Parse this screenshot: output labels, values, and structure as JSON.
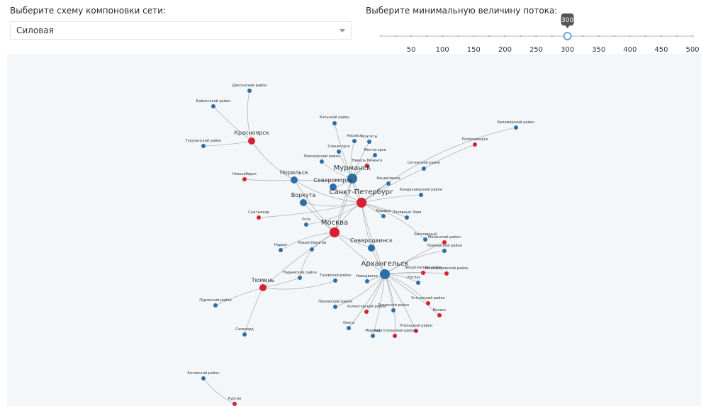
{
  "layout_control": {
    "label": "Выберите схему компоновки сети:",
    "selected": "Силовая"
  },
  "flow_control": {
    "label": "Выберите минимальную величину потока:",
    "value": 300,
    "min": 0,
    "max": 500,
    "step": 25,
    "tick_labels": [
      "50",
      "100",
      "150",
      "200",
      "250",
      "300",
      "350",
      "400",
      "450",
      "500"
    ]
  },
  "colors": {
    "node_blue": "#2e6ea5",
    "node_red": "#d62030",
    "edge": "#999999",
    "slider_track": "#d9dce0",
    "slider_handle": "#6fa4d1",
    "tooltip_bg": "#555555"
  },
  "network": {
    "nodes": [
      {
        "id": "dikson",
        "label": "Диксонский район",
        "type": "blue"
      },
      {
        "id": "baykit",
        "label": "Байкитский район",
        "type": "blue"
      },
      {
        "id": "krasnoyarsk",
        "label": "Красноярск",
        "type": "red",
        "size": "md"
      },
      {
        "id": "turukhansk",
        "label": "Туруханский район",
        "type": "blue"
      },
      {
        "id": "novosibirsk",
        "label": "Новосибирск",
        "type": "red"
      },
      {
        "id": "norilsk",
        "label": "Норильск",
        "type": "blue",
        "size": "md"
      },
      {
        "id": "kola",
        "label": "Кольский район",
        "type": "blue"
      },
      {
        "id": "kirovsk",
        "label": "Кировск",
        "type": "blue"
      },
      {
        "id": "apatity",
        "label": "Апатиты",
        "type": "blue"
      },
      {
        "id": "olenegorsk",
        "label": "Оленегорск",
        "type": "blue"
      },
      {
        "id": "lovozero",
        "label": "Ловозерский район",
        "type": "blue"
      },
      {
        "id": "monchegorsk",
        "label": "Мончегорск",
        "type": "blue"
      },
      {
        "id": "nikel",
        "label": "Никель Печенга",
        "type": "red"
      },
      {
        "id": "murmansk",
        "label": "Мурманск",
        "type": "blue",
        "size": "lg"
      },
      {
        "id": "severomorsk",
        "label": "Североморск",
        "type": "blue",
        "size": "md"
      },
      {
        "id": "segezha",
        "label": "Сегежский район",
        "type": "blue"
      },
      {
        "id": "petrozavodsk",
        "label": "Петрозаводск",
        "type": "red"
      },
      {
        "id": "belomorsk",
        "label": "Беломорский район",
        "type": "blue"
      },
      {
        "id": "kandalaksha",
        "label": "Кандалакша",
        "type": "blue"
      },
      {
        "id": "kandal_r",
        "label": "Кандалакшский район",
        "type": "blue"
      },
      {
        "id": "spb",
        "label": "Санкт-Петербург",
        "type": "red",
        "size": "lg"
      },
      {
        "id": "vorkuta",
        "label": "Воркута",
        "type": "blue",
        "size": "md"
      },
      {
        "id": "syktyvkar",
        "label": "Сыктывкар",
        "type": "red"
      },
      {
        "id": "ukhta",
        "label": "Ухта",
        "type": "blue"
      },
      {
        "id": "kirovsk2",
        "label": "Кировск",
        "type": "blue"
      },
      {
        "id": "polyarnye",
        "label": "Полярные Зори",
        "type": "blue"
      },
      {
        "id": "zapolyarny",
        "label": "Заполярный",
        "type": "blue"
      },
      {
        "id": "moscow",
        "label": "Москва",
        "type": "red",
        "size": "lg"
      },
      {
        "id": "nadym",
        "label": "Надым",
        "type": "blue"
      },
      {
        "id": "urengoy",
        "label": "Новый Уренгой",
        "type": "blue"
      },
      {
        "id": "severodvinsk",
        "label": "Северодвинск",
        "type": "blue",
        "size": "md"
      },
      {
        "id": "mezen",
        "label": "Мезенский район",
        "type": "red"
      },
      {
        "id": "primorsky",
        "label": "Приморский район",
        "type": "blue"
      },
      {
        "id": "arkhangelsk",
        "label": "Архангельск",
        "type": "blue",
        "size": "lg"
      },
      {
        "id": "leshukon",
        "label": "Лешуконский район",
        "type": "red"
      },
      {
        "id": "vinogradov",
        "label": "Виноградовский район",
        "type": "red"
      },
      {
        "id": "kotlas",
        "label": "Котлас",
        "type": "blue"
      },
      {
        "id": "novodvinsk",
        "label": "Новодвинск",
        "type": "blue"
      },
      {
        "id": "tyumen",
        "label": "Тюмень",
        "type": "red",
        "size": "md"
      },
      {
        "id": "nadym_r",
        "label": "Надымский район",
        "type": "blue"
      },
      {
        "id": "tazovsky",
        "label": "Тазовский район",
        "type": "blue"
      },
      {
        "id": "purovsky",
        "label": "Пуровский район",
        "type": "blue"
      },
      {
        "id": "salekhard",
        "label": "Салехард",
        "type": "blue"
      },
      {
        "id": "pinega",
        "label": "Пинежский район",
        "type": "blue"
      },
      {
        "id": "kholmogory",
        "label": "Холмогорский район",
        "type": "red"
      },
      {
        "id": "onega_r",
        "label": "Онежский район",
        "type": "blue"
      },
      {
        "id": "ustyansky",
        "label": "Устьянский район",
        "type": "red"
      },
      {
        "id": "velsk",
        "label": "Вельск",
        "type": "red"
      },
      {
        "id": "plesetsk",
        "label": "Плесецкий район",
        "type": "red"
      },
      {
        "id": "kargopol",
        "label": "Каргопольский район",
        "type": "red"
      },
      {
        "id": "onega",
        "label": "Онега",
        "type": "blue"
      },
      {
        "id": "mirny",
        "label": "Мирный",
        "type": "blue"
      },
      {
        "id": "kurgan_r",
        "label": "Кетовский район",
        "type": "blue"
      },
      {
        "id": "kurgan",
        "label": "Курган",
        "type": "red"
      }
    ],
    "edges": [
      [
        "dikson",
        "krasnoyarsk"
      ],
      [
        "baykit",
        "krasnoyarsk"
      ],
      [
        "turukhansk",
        "krasnoyarsk"
      ],
      [
        "krasnoyarsk",
        "norilsk"
      ],
      [
        "novosibirsk",
        "norilsk"
      ],
      [
        "norilsk",
        "murmansk"
      ],
      [
        "norilsk",
        "spb"
      ],
      [
        "norilsk",
        "moscow"
      ],
      [
        "kola",
        "murmansk"
      ],
      [
        "kirovsk",
        "murmansk"
      ],
      [
        "apatity",
        "murmansk"
      ],
      [
        "olenegorsk",
        "murmansk"
      ],
      [
        "lovozero",
        "murmansk"
      ],
      [
        "monchegorsk",
        "murmansk"
      ],
      [
        "nikel",
        "murmansk"
      ],
      [
        "murmansk",
        "spb"
      ],
      [
        "murmansk",
        "moscow"
      ],
      [
        "severomorsk",
        "spb"
      ],
      [
        "severomorsk",
        "murmansk"
      ],
      [
        "segezha",
        "spb"
      ],
      [
        "petrozavodsk",
        "segezha"
      ],
      [
        "belomorsk",
        "spb"
      ],
      [
        "kandalaksha",
        "spb"
      ],
      [
        "kandal_r",
        "spb"
      ],
      [
        "spb",
        "moscow"
      ],
      [
        "spb",
        "arkhangelsk"
      ],
      [
        "spb",
        "severodvinsk"
      ],
      [
        "vorkuta",
        "spb"
      ],
      [
        "vorkuta",
        "moscow"
      ],
      [
        "syktyvkar",
        "spb"
      ],
      [
        "ukhta",
        "spb"
      ],
      [
        "kirovsk2",
        "spb"
      ],
      [
        "polyarnye",
        "spb"
      ],
      [
        "zapolyarny",
        "spb"
      ],
      [
        "moscow",
        "arkhangelsk"
      ],
      [
        "moscow",
        "severodvinsk"
      ],
      [
        "moscow",
        "nadym"
      ],
      [
        "moscow",
        "urengoy"
      ],
      [
        "moscow",
        "tyumen"
      ],
      [
        "urengoy",
        "nadym_r"
      ],
      [
        "severodvinsk",
        "arkhangelsk"
      ],
      [
        "mezen",
        "arkhangelsk"
      ],
      [
        "primorsky",
        "arkhangelsk"
      ],
      [
        "leshukon",
        "arkhangelsk"
      ],
      [
        "vinogradov",
        "arkhangelsk"
      ],
      [
        "kotlas",
        "arkhangelsk"
      ],
      [
        "novodvinsk",
        "arkhangelsk"
      ],
      [
        "tyumen",
        "nadym_r"
      ],
      [
        "tyumen",
        "tazovsky"
      ],
      [
        "tyumen",
        "purovsky"
      ],
      [
        "tyumen",
        "salekhard"
      ],
      [
        "pinega",
        "arkhangelsk"
      ],
      [
        "kholmogory",
        "arkhangelsk"
      ],
      [
        "onega_r",
        "arkhangelsk"
      ],
      [
        "ustyansky",
        "arkhangelsk"
      ],
      [
        "velsk",
        "arkhangelsk"
      ],
      [
        "plesetsk",
        "arkhangelsk"
      ],
      [
        "kargopol",
        "arkhangelsk"
      ],
      [
        "onega",
        "arkhangelsk"
      ],
      [
        "mirny",
        "arkhangelsk"
      ],
      [
        "kurgan_r",
        "kurgan"
      ],
      [
        "spb",
        "murmansk"
      ],
      [
        "moscow",
        "murmansk"
      ]
    ]
  }
}
